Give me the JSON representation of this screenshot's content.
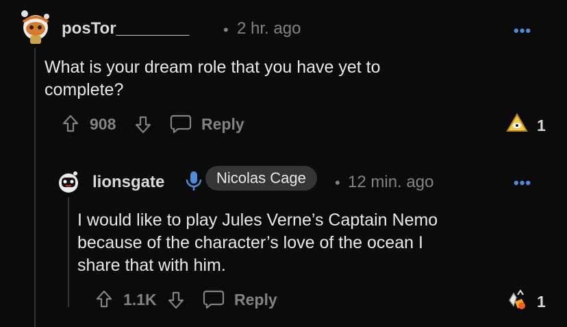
{
  "comment": {
    "username": "posTor________",
    "separator": "•",
    "time": "2 hr. ago",
    "more_label": "•••",
    "body_lines": [
      "What is your dream role that you have yet to",
      "complete?"
    ],
    "vote_count": "908",
    "reply_label": "Reply",
    "award_count": "1"
  },
  "reply": {
    "username": "lionsgate",
    "flair": "Nicolas Cage",
    "separator": "•",
    "time": "12 min. ago",
    "more_label": "•••",
    "body_lines": [
      "I would like to play Jules Verne’s Captain Nemo",
      "because of the character’s love of the ocean I",
      "share that with him."
    ],
    "vote_count": "1.1K",
    "reply_label": "Reply",
    "award_count": "1"
  },
  "colors": {
    "background": "#0b0b0c",
    "accent_blue": "#4f8cd6",
    "muted": "#818384",
    "flair_bg": "#343536"
  },
  "icons": [
    "avatar-snoo-orange",
    "upvote-icon",
    "downvote-icon",
    "comment-bubble-icon",
    "award-icon",
    "microphone-icon",
    "avatar-snoo-black"
  ]
}
